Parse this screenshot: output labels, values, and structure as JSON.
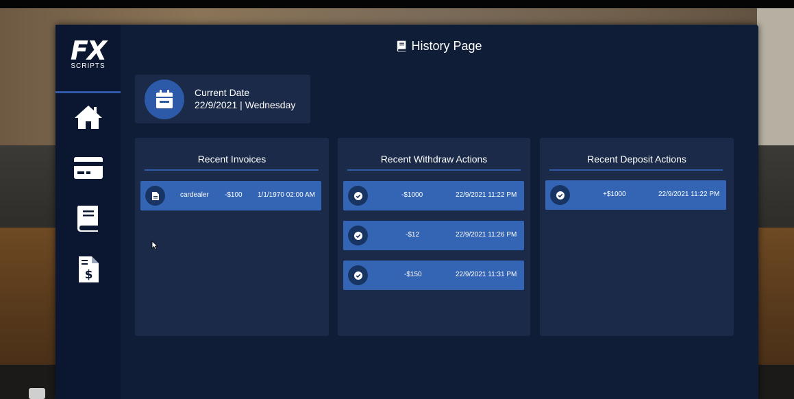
{
  "app": {
    "logo_main": "FX",
    "logo_sub": "SCRIPTS",
    "page_title": "History Page"
  },
  "sidebar": {
    "items": [
      {
        "icon": "home-icon"
      },
      {
        "icon": "credit-card-icon"
      },
      {
        "icon": "book-icon"
      },
      {
        "icon": "invoice-dollar-icon"
      }
    ]
  },
  "date_card": {
    "label": "Current Date",
    "value": "22/9/2021 | Wednesday"
  },
  "invoices": {
    "title": "Recent Invoices",
    "rows": [
      {
        "name": "cardealer",
        "amount": "-$100",
        "datetime": "1/1/1970 02:00 AM"
      }
    ]
  },
  "withdraws": {
    "title": "Recent Withdraw Actions",
    "rows": [
      {
        "amount": "-$1000",
        "datetime": "22/9/2021 11:22 PM"
      },
      {
        "amount": "-$12",
        "datetime": "22/9/2021 11:26 PM"
      },
      {
        "amount": "-$150",
        "datetime": "22/9/2021 11:31 PM"
      }
    ]
  },
  "deposits": {
    "title": "Recent Deposit Actions",
    "rows": [
      {
        "amount": "+$1000",
        "datetime": "22/9/2021 11:22 PM"
      }
    ]
  },
  "colors": {
    "panel": "#0f1d36",
    "sidebar": "#0b1730",
    "card": "#1a2a48",
    "accent": "#3465b5",
    "rule": "#2f5aa7"
  }
}
